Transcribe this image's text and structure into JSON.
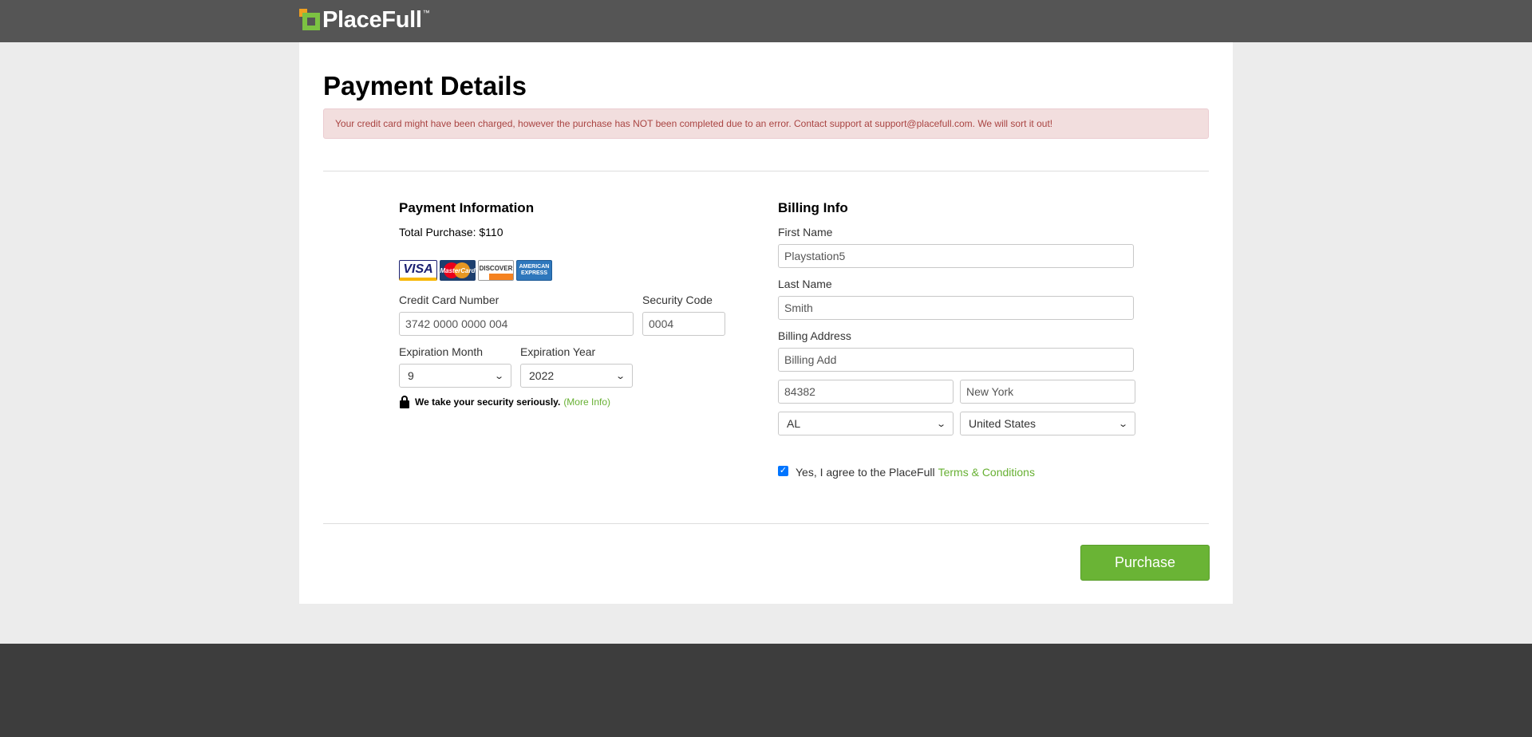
{
  "header": {
    "logo_text": "PlaceFull",
    "logo_tm": "™"
  },
  "page": {
    "title": "Payment Details",
    "alert": "Your credit card might have been charged, however the purchase has NOT been completed due to an error. Contact support at support@placefull.com. We will sort it out!"
  },
  "payment": {
    "heading": "Payment Information",
    "total": "Total Purchase: $110",
    "cards": [
      "VISA",
      "MasterCard",
      "DISCOVER",
      "AMERICAN EXPRESS"
    ],
    "cc_label": "Credit Card Number",
    "cc_value": "3742 0000 0000 004",
    "sec_label": "Security Code",
    "sec_value": "0004",
    "month_label": "Expiration Month",
    "month_value": "9",
    "year_label": "Expiration Year",
    "year_value": "2022",
    "secure_text": "We take your security seriously.",
    "more_info": "(More Info)"
  },
  "billing": {
    "heading": "Billing Info",
    "first_label": "First Name",
    "first_value": "Playstation5",
    "last_label": "Last Name",
    "last_value": "Smith",
    "address_label": "Billing Address",
    "address_value": "Billing Add",
    "zip_value": "84382",
    "city_value": "New York",
    "state_value": "AL",
    "country_value": "United States"
  },
  "agree": {
    "text": "Yes, I agree to the PlaceFull",
    "link": "Terms & Conditions",
    "checked": true
  },
  "actions": {
    "purchase_label": "Purchase"
  },
  "colors": {
    "accent": "#6ab435",
    "header_bg": "#555555",
    "footer_bg": "#3d3d3d",
    "alert_bg": "#f2dede",
    "alert_text": "#a94442"
  }
}
